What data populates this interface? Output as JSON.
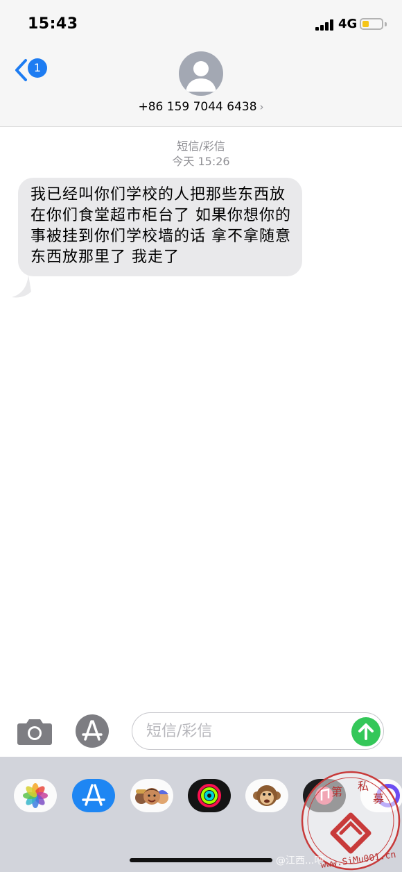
{
  "status_bar": {
    "time": "15:43",
    "network": "4G",
    "battery_level": 0.35,
    "battery_color": "#f5c518"
  },
  "header": {
    "back_badge_count": "1",
    "contact": "+86 159 7044 6438",
    "contact_chevron": "›",
    "accent_color": "#1d7cf2"
  },
  "conversation": {
    "service_label": "短信/彩信",
    "timestamp": "今天 15:26",
    "message": "我已经叫你们学校的人把那些东西放在你们食堂超市柜台了 如果你想你的事被挂到你们学校墙的话 拿不拿随意 东西放那里了 我走了",
    "bubble_color": "#e9e9eb"
  },
  "input_bar": {
    "placeholder": "短信/彩信",
    "value": "",
    "send_color": "#34c759",
    "camera_icon": "camera-icon",
    "apps_icon": "app-store-icon"
  },
  "app_drawer": {
    "apps": [
      "photos-icon",
      "app-store-icon",
      "memoji-stickers-icon",
      "activity-rings-icon",
      "animoji-monkey-icon",
      "music-icon",
      "more-apps-icon"
    ]
  },
  "watermark": {
    "seal_text": "第一私募",
    "seal_url": "www.SiMu001.cn",
    "credit_text": "@江西...吧"
  }
}
